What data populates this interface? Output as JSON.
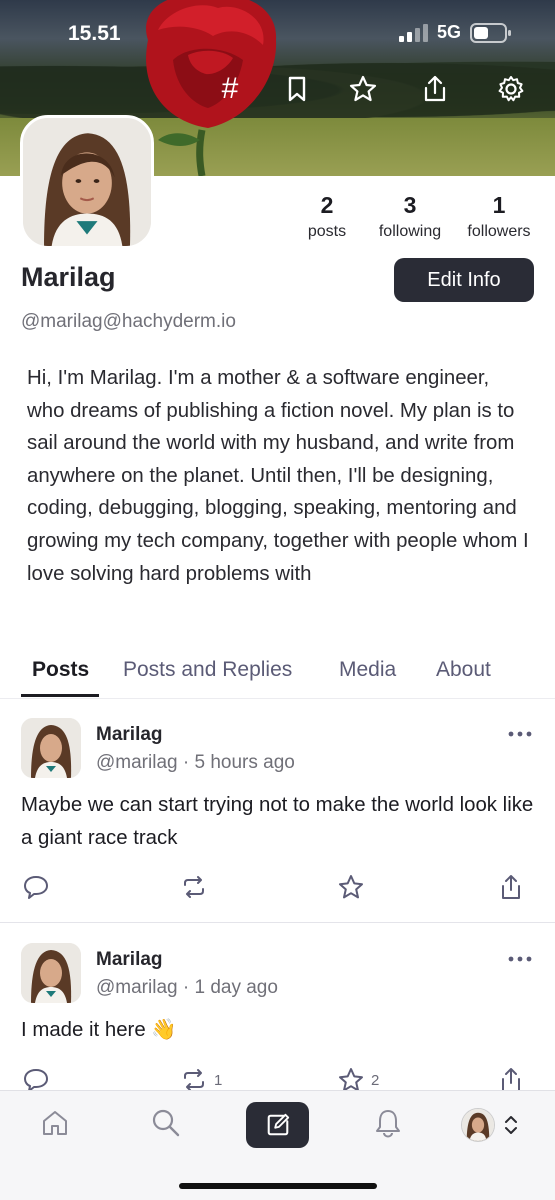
{
  "status_bar": {
    "time": "15.51",
    "network": "5G"
  },
  "header_icons": [
    "hashtag-icon",
    "bookmark-icon",
    "star-icon",
    "share-icon",
    "gear-icon"
  ],
  "header_hash_glyph": "#",
  "profile": {
    "display_name": "Marilag",
    "handle": "@marilag@hachyderm.io",
    "edit_label": "Edit Info",
    "bio": "Hi, I'm Marilag. I'm a mother & a software engineer, who dreams of publishing a fiction novel. My plan is to sail around the world with my husband, and write from anywhere on the planet. Until then, I'll be designing, coding, debugging, blogging, speaking, mentoring and growing my tech company, together with people whom I love solving hard problems with",
    "stats": {
      "posts": {
        "value": "2",
        "label": "posts"
      },
      "following": {
        "value": "3",
        "label": "following"
      },
      "followers": {
        "value": "1",
        "label": "followers"
      }
    }
  },
  "tabs": [
    {
      "label": "Posts",
      "active": true
    },
    {
      "label": "Posts and Replies",
      "active": false
    },
    {
      "label": "Media",
      "active": false
    },
    {
      "label": "About",
      "active": false
    }
  ],
  "posts": [
    {
      "name": "Marilag",
      "meta": "@marilag · 5 hours ago",
      "text": "Maybe we can start trying not to make the world look like a giant race track",
      "boost_count": "",
      "favourite_count": ""
    },
    {
      "name": "Marilag",
      "meta": "@marilag · 1 day ago",
      "text": "I made it here 👋",
      "boost_count": "1",
      "favourite_count": "2"
    }
  ],
  "colors": {
    "accent_dark": "#2a2c36",
    "tab_inactive": "#5b5b76",
    "muted": "#707078"
  }
}
